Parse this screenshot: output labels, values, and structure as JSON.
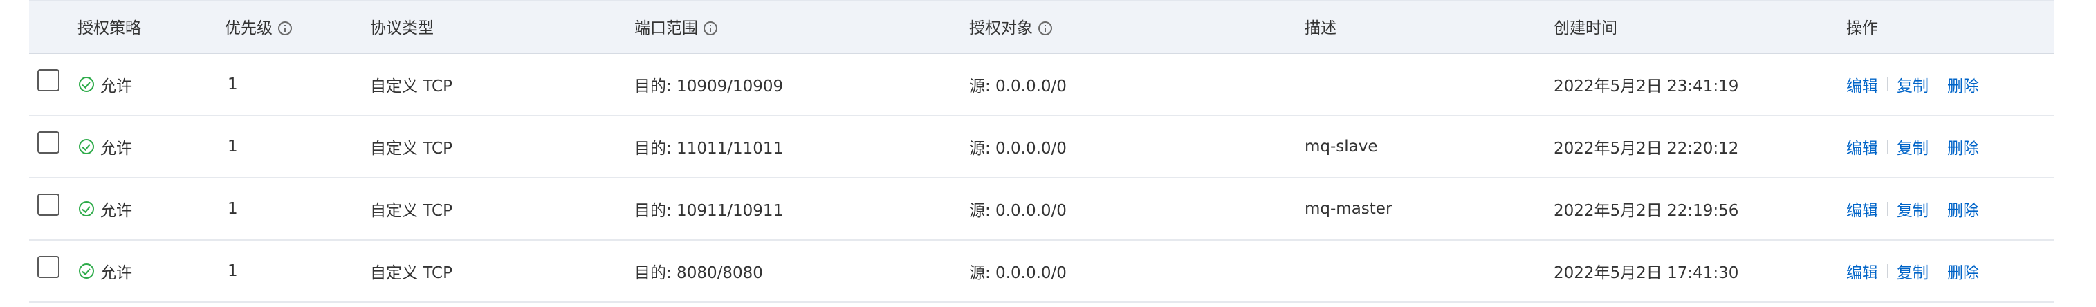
{
  "table": {
    "headers": {
      "policy": "授权策略",
      "priority": "优先级",
      "protocol": "协议类型",
      "port_range": "端口范围",
      "auth_object": "授权对象",
      "description": "描述",
      "created_time": "创建时间",
      "actions": "操作"
    },
    "info_icons": [
      "priority",
      "port_range",
      "auth_object"
    ],
    "rows": [
      {
        "policy": "允许",
        "priority": "1",
        "protocol": "自定义 TCP",
        "port_range": "目的: 10909/10909",
        "auth_object": "源: 0.0.0.0/0",
        "description": "",
        "created_time": "2022年5月2日 23:41:19"
      },
      {
        "policy": "允许",
        "priority": "1",
        "protocol": "自定义 TCP",
        "port_range": "目的: 11011/11011",
        "auth_object": "源: 0.0.0.0/0",
        "description": "mq-slave",
        "created_time": "2022年5月2日 22:20:12"
      },
      {
        "policy": "允许",
        "priority": "1",
        "protocol": "自定义 TCP",
        "port_range": "目的: 10911/10911",
        "auth_object": "源: 0.0.0.0/0",
        "description": "mq-master",
        "created_time": "2022年5月2日 22:19:56"
      },
      {
        "policy": "允许",
        "priority": "1",
        "protocol": "自定义 TCP",
        "port_range": "目的: 8080/8080",
        "auth_object": "源: 0.0.0.0/0",
        "description": "",
        "created_time": "2022年5月2日 17:41:30"
      }
    ],
    "actions": {
      "edit": "编辑",
      "copy": "复制",
      "delete": "删除"
    }
  },
  "colors": {
    "link": "#0064c8",
    "allow_icon": "#2eab4a",
    "header_bg": "#f0f3f8"
  }
}
